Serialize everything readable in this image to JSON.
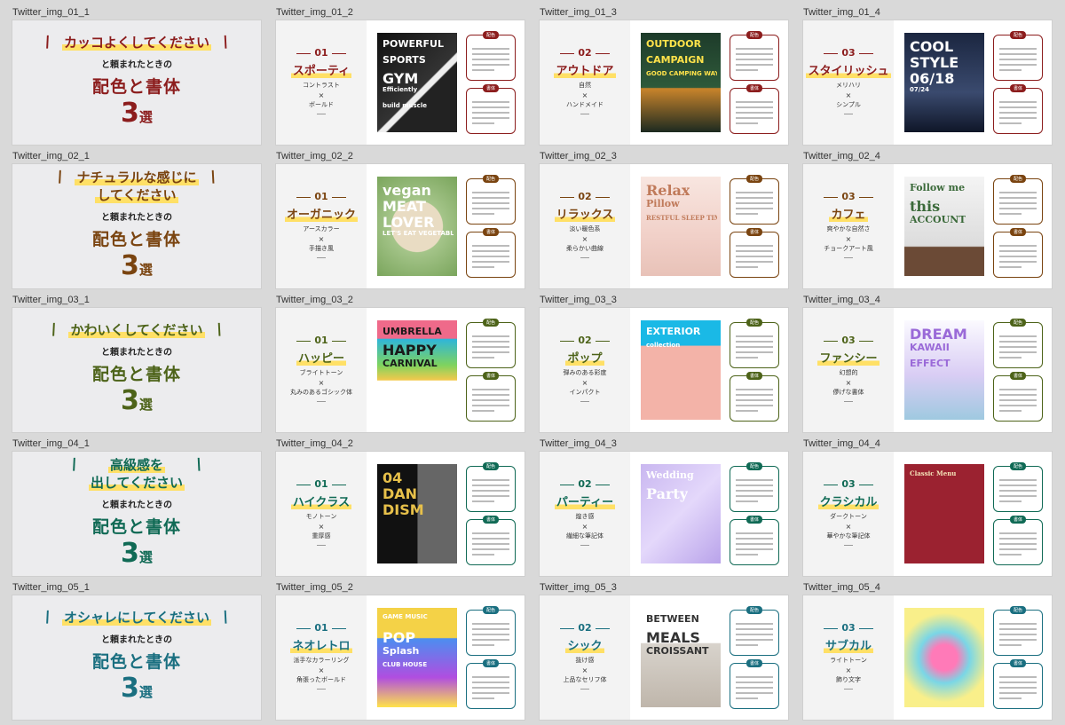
{
  "rows": [
    {
      "color": "#8c1d1d",
      "labels": [
        "Twitter_img_01_1",
        "Twitter_img_01_2",
        "Twitter_img_01_3",
        "Twitter_img_01_4"
      ],
      "title": {
        "lines": [
          "カッコよくしてください"
        ],
        "sub": "と頼まれたときの",
        "big": "配色と書体",
        "num": "3",
        "unit": "選"
      },
      "slides": [
        {
          "num": "01",
          "name": "スポーティ",
          "d1": "コントラスト",
          "x": "×",
          "d2": "ボールド",
          "poster": [
            "POWERFUL",
            "SPORTS",
            "GYM",
            "Efficiently",
            "build muscle"
          ]
        },
        {
          "num": "02",
          "name": "アウトドア",
          "d1": "自然",
          "x": "×",
          "d2": "ハンドメイド",
          "poster": [
            "OUTDOOR",
            "CAMPAIGN",
            "GOOD CAMPING WAY"
          ]
        },
        {
          "num": "03",
          "name": "スタイリッシュ",
          "d1": "メリハリ",
          "x": "×",
          "d2": "シンプル",
          "poster": [
            "COOL",
            "STYLE",
            "06/18",
            "07/24"
          ]
        }
      ]
    },
    {
      "color": "#7a4410",
      "labels": [
        "Twitter_img_02_1",
        "Twitter_img_02_2",
        "Twitter_img_02_3",
        "Twitter_img_02_4"
      ],
      "title": {
        "lines": [
          "ナチュラルな感じに",
          "してください"
        ],
        "sub": "と頼まれたときの",
        "big": "配色と書体",
        "num": "3",
        "unit": "選"
      },
      "slides": [
        {
          "num": "01",
          "name": "オーガニック",
          "d1": "アースカラー",
          "x": "×",
          "d2": "手描き風",
          "poster": [
            "vegan",
            "MEAT",
            "LOVER",
            "LET'S EAT VEGETABLES"
          ]
        },
        {
          "num": "02",
          "name": "リラックス",
          "d1": "淡い暖色系",
          "x": "×",
          "d2": "柔らかい曲線",
          "poster": [
            "Relax",
            "Pillow",
            "RESTFUL SLEEP TIME"
          ]
        },
        {
          "num": "03",
          "name": "カフェ",
          "d1": "爽やかな自然さ",
          "x": "×",
          "d2": "チョークアート風",
          "poster": [
            "Follow me",
            "this",
            "ACCOUNT"
          ]
        }
      ]
    },
    {
      "color": "#4d6319",
      "labels": [
        "Twitter_img_03_1",
        "Twitter_img_03_2",
        "Twitter_img_03_3",
        "Twitter_img_03_4"
      ],
      "title": {
        "lines": [
          "かわいくしてください"
        ],
        "sub": "と頼まれたときの",
        "big": "配色と書体",
        "num": "3",
        "unit": "選"
      },
      "slides": [
        {
          "num": "01",
          "name": "ハッピー",
          "d1": "ブライトトーン",
          "x": "×",
          "d2": "丸みのあるゴシック体",
          "poster": [
            "UMBRELLA",
            "HAPPY",
            "CARNIVAL"
          ]
        },
        {
          "num": "02",
          "name": "ポップ",
          "d1": "弾みのある彩度",
          "x": "×",
          "d2": "インパクト",
          "poster": [
            "EXTERIOR",
            "collection"
          ]
        },
        {
          "num": "03",
          "name": "ファンシー",
          "d1": "幻想的",
          "x": "×",
          "d2": "儚げな書体",
          "poster": [
            "DREAM",
            "KAWAII",
            "EFFECT"
          ]
        }
      ]
    },
    {
      "color": "#106a55",
      "labels": [
        "Twitter_img_04_1",
        "Twitter_img_04_2",
        "Twitter_img_04_3",
        "Twitter_img_04_4"
      ],
      "title": {
        "lines": [
          "高級感を",
          "出してください"
        ],
        "sub": "と頼まれたときの",
        "big": "配色と書体",
        "num": "3",
        "unit": "選"
      },
      "slides": [
        {
          "num": "01",
          "name": "ハイクラス",
          "d1": "モノトーン",
          "x": "×",
          "d2": "重厚感",
          "poster": [
            "04",
            "DAN",
            "DISM"
          ]
        },
        {
          "num": "02",
          "name": "パーティー",
          "d1": "煌き感",
          "x": "×",
          "d2": "繊細な筆記体",
          "poster": [
            "Wedding",
            "Party"
          ]
        },
        {
          "num": "03",
          "name": "クラシカル",
          "d1": "ダークトーン",
          "x": "×",
          "d2": "華やかな筆記体",
          "poster": [
            "Classic Menu"
          ]
        }
      ]
    },
    {
      "color": "#1a6f80",
      "labels": [
        "Twitter_img_05_1",
        "Twitter_img_05_2",
        "Twitter_img_05_3",
        "Twitter_img_05_4"
      ],
      "title": {
        "lines": [
          "オシャレにしてください"
        ],
        "sub": "と頼まれたときの",
        "big": "配色と書体",
        "num": "3",
        "unit": "選"
      },
      "slides": [
        {
          "num": "01",
          "name": "ネオレトロ",
          "d1": "派手なカラーリング",
          "x": "×",
          "d2": "角張ったボールド",
          "poster": [
            "GAME MUSIC",
            "POP",
            "Splash",
            "CLUB HOUSE"
          ]
        },
        {
          "num": "02",
          "name": "シック",
          "d1": "抜け感",
          "x": "×",
          "d2": "上品なセリフ体",
          "poster": [
            "BETWEEN",
            "MEALS",
            "CROISSANT"
          ]
        },
        {
          "num": "03",
          "name": "サブカル",
          "d1": "ライトトーン",
          "x": "×",
          "d2": "飾り文字",
          "poster": []
        }
      ]
    }
  ],
  "box_tags": [
    "配色",
    "書体"
  ]
}
